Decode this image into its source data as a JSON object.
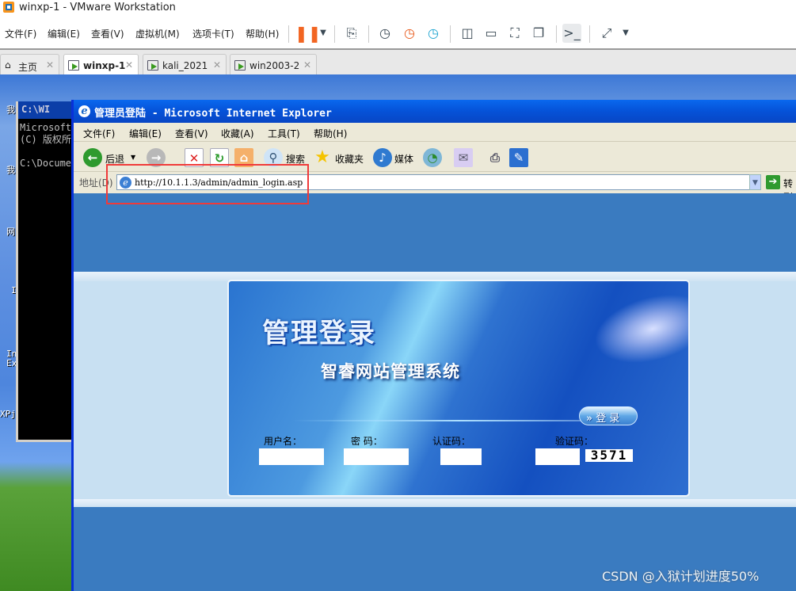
{
  "vmware": {
    "title": "winxp-1 - VMware Workstation",
    "menu": [
      "文件(F)",
      "编辑(E)",
      "查看(V)",
      "虚拟机(M)",
      "选项卡(T)",
      "帮助(H)"
    ],
    "tabs": [
      {
        "label": "主页",
        "active": false
      },
      {
        "label": "winxp-1",
        "active": true
      },
      {
        "label": "kali_2021",
        "active": false
      },
      {
        "label": "win2003-2",
        "active": false
      }
    ],
    "pause_color": "#f26522"
  },
  "desktop": {
    "icon_labels": [
      "我",
      "我",
      "网",
      "I",
      "In",
      "Ex",
      "XPj"
    ]
  },
  "cmd": {
    "title": "C:\\WI",
    "lines": "Microsoft\n(C) 版权所\n\nC:\\Docume"
  },
  "ie": {
    "title": "管理员登陆 - Microsoft Internet Explorer",
    "menu": [
      "文件(F)",
      "编辑(E)",
      "查看(V)",
      "收藏(A)",
      "工具(T)",
      "帮助(H)"
    ],
    "toolbar": {
      "back": "后退",
      "search": "搜索",
      "favorites": "收藏夹",
      "media": "媒体"
    },
    "address_label": "地址(D)",
    "url": "http://10.1.1.3/admin/admin_login.asp",
    "go": "转到"
  },
  "login": {
    "heading": "管理登录",
    "subtitle": "智睿网站管理系统",
    "button": "» 登 录",
    "username_label": "用户名：",
    "password_label": "密  码：",
    "auth_label": "认证码：",
    "verify_label": "验证码：",
    "captcha": "3571"
  },
  "watermark": "CSDN @入狱计划进度50%",
  "highlight_color": "#f03a3a"
}
